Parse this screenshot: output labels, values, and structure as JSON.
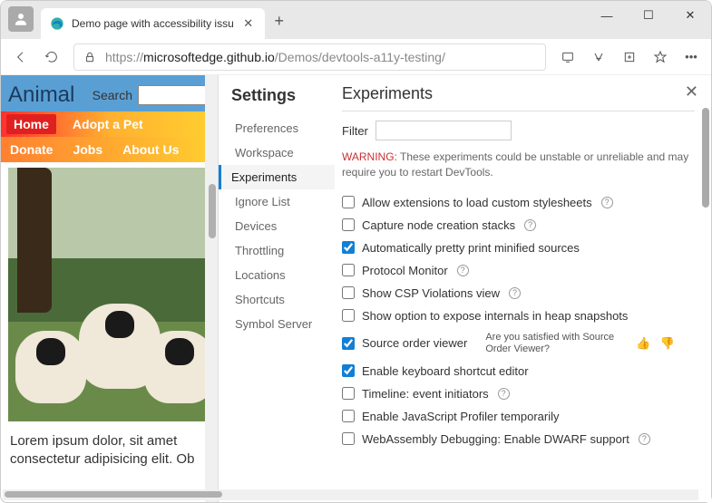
{
  "window": {
    "tab_title": "Demo page with accessibility issu"
  },
  "address": {
    "protocol": "https://",
    "host": "microsoftedge.github.io",
    "path": "/Demos/devtools-a11y-testing/"
  },
  "site": {
    "brand": "Animal",
    "search_label": "Search",
    "nav1": {
      "home": "Home",
      "adopt": "Adopt a Pet"
    },
    "nav2": {
      "donate": "Donate",
      "jobs": "Jobs",
      "about": "About Us"
    },
    "para": "Lorem ipsum dolor, sit amet consectetur adipisicing elit. Ob"
  },
  "settings": {
    "title": "Settings",
    "items": [
      "Preferences",
      "Workspace",
      "Experiments",
      "Ignore List",
      "Devices",
      "Throttling",
      "Locations",
      "Shortcuts",
      "Symbol Server"
    ],
    "active_index": 2
  },
  "experiments": {
    "title": "Experiments",
    "filter_label": "Filter",
    "warning_label": "WARNING:",
    "warning_text": " These experiments could be unstable or unreliable and may require you to restart DevTools.",
    "feedback_prompt": "Are you satisfied with Source Order Viewer?",
    "items": [
      {
        "label": "Allow extensions to load custom stylesheets",
        "checked": false,
        "help": true
      },
      {
        "label": "Capture node creation stacks",
        "checked": false,
        "help": true
      },
      {
        "label": "Automatically pretty print minified sources",
        "checked": true,
        "help": false
      },
      {
        "label": "Protocol Monitor",
        "checked": false,
        "help": true
      },
      {
        "label": "Show CSP Violations view",
        "checked": false,
        "help": true
      },
      {
        "label": "Show option to expose internals in heap snapshots",
        "checked": false,
        "help": false
      },
      {
        "label": "Source order viewer",
        "checked": true,
        "help": false,
        "feedback": true
      },
      {
        "label": "Enable keyboard shortcut editor",
        "checked": true,
        "help": false
      },
      {
        "label": "Timeline: event initiators",
        "checked": false,
        "help": true
      },
      {
        "label": "Enable JavaScript Profiler temporarily",
        "checked": false,
        "help": false
      },
      {
        "label": "WebAssembly Debugging: Enable DWARF support",
        "checked": false,
        "help": true
      }
    ]
  }
}
